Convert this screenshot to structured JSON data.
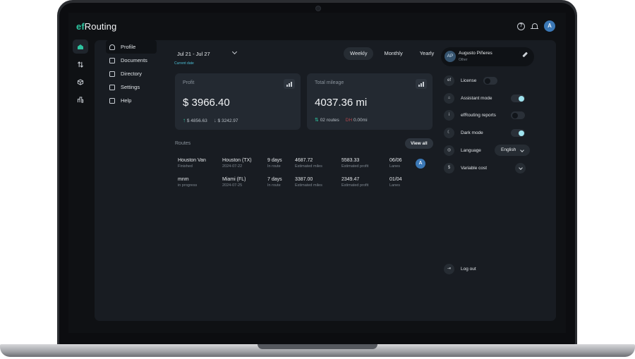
{
  "header": {
    "brand_prefix": "ef",
    "brand_suffix": "Routing",
    "avatar_initial": "A"
  },
  "rail": [
    "home-icon",
    "routes-icon",
    "package-icon",
    "buildings-icon"
  ],
  "subnav": [
    {
      "label": "Profile",
      "icon": "person-icon",
      "active": true
    },
    {
      "label": "Documents",
      "icon": "document-icon"
    },
    {
      "label": "Directory",
      "icon": "book-icon"
    },
    {
      "label": "Settings",
      "icon": "sliders-icon"
    },
    {
      "label": "Help",
      "icon": "info-icon"
    }
  ],
  "dashboard": {
    "date_range": "Jul 21 - Jul 27",
    "current_date_label": "Current date",
    "periods": [
      "Weekly",
      "Monthly",
      "Yearly"
    ],
    "active_period": "Weekly",
    "profit": {
      "title": "Profit",
      "value": "$ 3966.40",
      "up": "$ 4856.63",
      "down": "$ 3242.97"
    },
    "mileage": {
      "title": "Total mileage",
      "value": "4037.36 mi",
      "routes": "02 routes",
      "dh_label": "DH",
      "dh_value": "0.00mi"
    },
    "routes_title": "Routes",
    "view_all": "View all",
    "routes": [
      {
        "name": "Houston Van",
        "status": "Finished",
        "dest": "Houston (TX)",
        "date": "2024-07-22",
        "days": "9 days",
        "days_sub": "In route",
        "miles": "4687.72",
        "miles_sub": "Estimated miles",
        "profit": "5583.33",
        "profit_sub": "Estimated profit",
        "lanes": "06/06",
        "lanes_sub": "Lanes",
        "avatar": "A"
      },
      {
        "name": "mnm",
        "status": "in progress",
        "dest": "Miami (FL)",
        "date": "2024-07-25",
        "days": "7 days",
        "days_sub": "In route",
        "miles": "3387.00",
        "miles_sub": "Estimated miles",
        "profit": "2349.47",
        "profit_sub": "Estimated profit",
        "lanes": "01/04",
        "lanes_sub": "Lanes"
      }
    ]
  },
  "user": {
    "initials": "AP",
    "name": "Augusto Piñeres",
    "role": "Other"
  },
  "settings": {
    "license": "License",
    "assistant": "Assistant mode",
    "reports": "efRouting reports",
    "dark": "Dark mode",
    "language": "Language",
    "language_value": "English",
    "variable_cost": "Variable cost",
    "logout": "Log out",
    "license_icon": "ef"
  },
  "colors": {
    "accent": "#2ec4a0",
    "toggle_on": "#9fe3ef",
    "avatar": "#3b78b6",
    "panel": "#181c22"
  }
}
